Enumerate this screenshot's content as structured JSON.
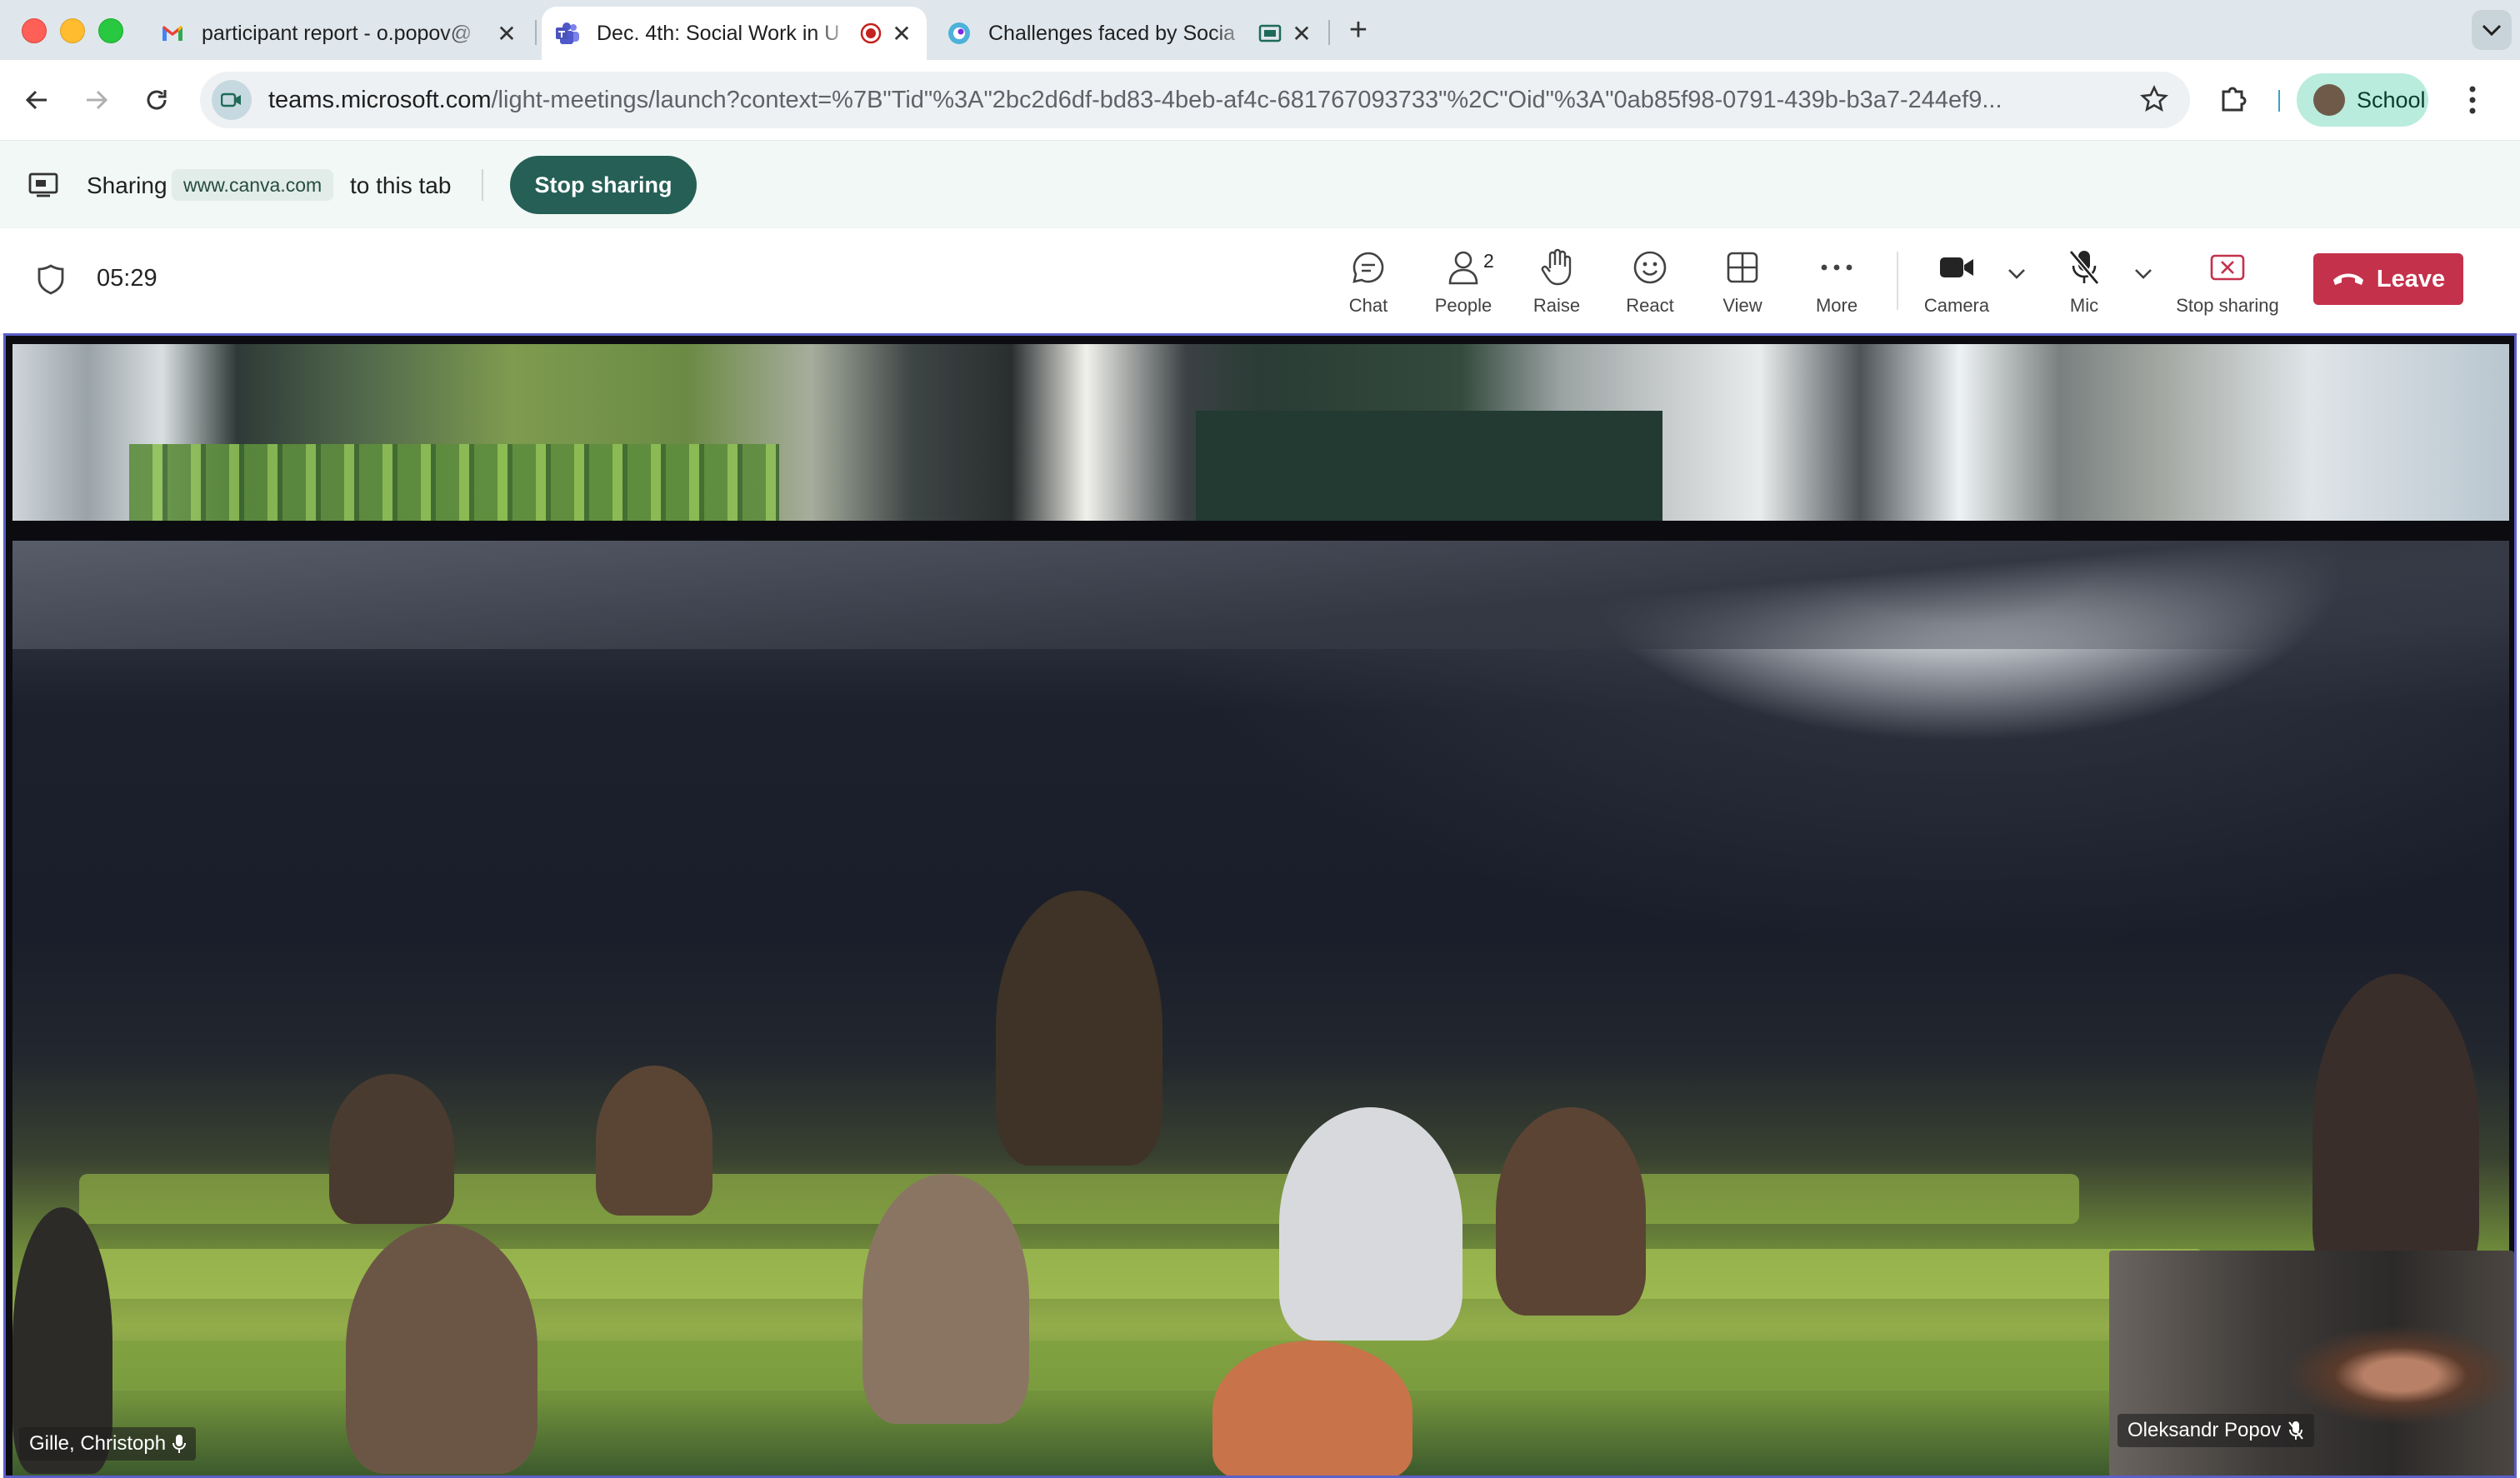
{
  "browser": {
    "tabs": [
      {
        "title": "participant report - o.popov@",
        "icon": "gmail-icon",
        "active": false
      },
      {
        "title": "Dec. 4th: Social Work in U",
        "icon": "teams-icon",
        "active": true,
        "recording": true
      },
      {
        "title": "Challenges faced by Socia",
        "icon": "canva-icon",
        "active": false,
        "sharing": true
      }
    ],
    "new_tab_label": "+",
    "url_host": "teams.microsoft.com",
    "url_path": "/light-meetings/launch?context=%7B\"Tid\"%3A\"2bc2d6df-bd83-4beb-af4c-681767093733\"%2C\"Oid\"%3A\"0ab85f98-0791-439b-b3a7-244ef9...",
    "profile_label": "School"
  },
  "sharing_bar": {
    "prefix": "Sharing",
    "domain": "www.canva.com",
    "suffix": "to this tab",
    "stop_label": "Stop sharing"
  },
  "meeting": {
    "timer": "05:29",
    "controls": {
      "chat": "Chat",
      "people": "People",
      "people_count": "2",
      "raise": "Raise",
      "react": "React",
      "view": "View",
      "more": "More",
      "camera": "Camera",
      "mic": "Mic",
      "stop_sharing": "Stop sharing",
      "leave": "Leave"
    },
    "participants": {
      "main": "Gille, Christoph",
      "self": "Oleksandr Popov"
    }
  },
  "colors": {
    "teams_purple": "#5b5fc7",
    "leave_red": "#c4314b",
    "stop_share_green": "#255f56"
  }
}
